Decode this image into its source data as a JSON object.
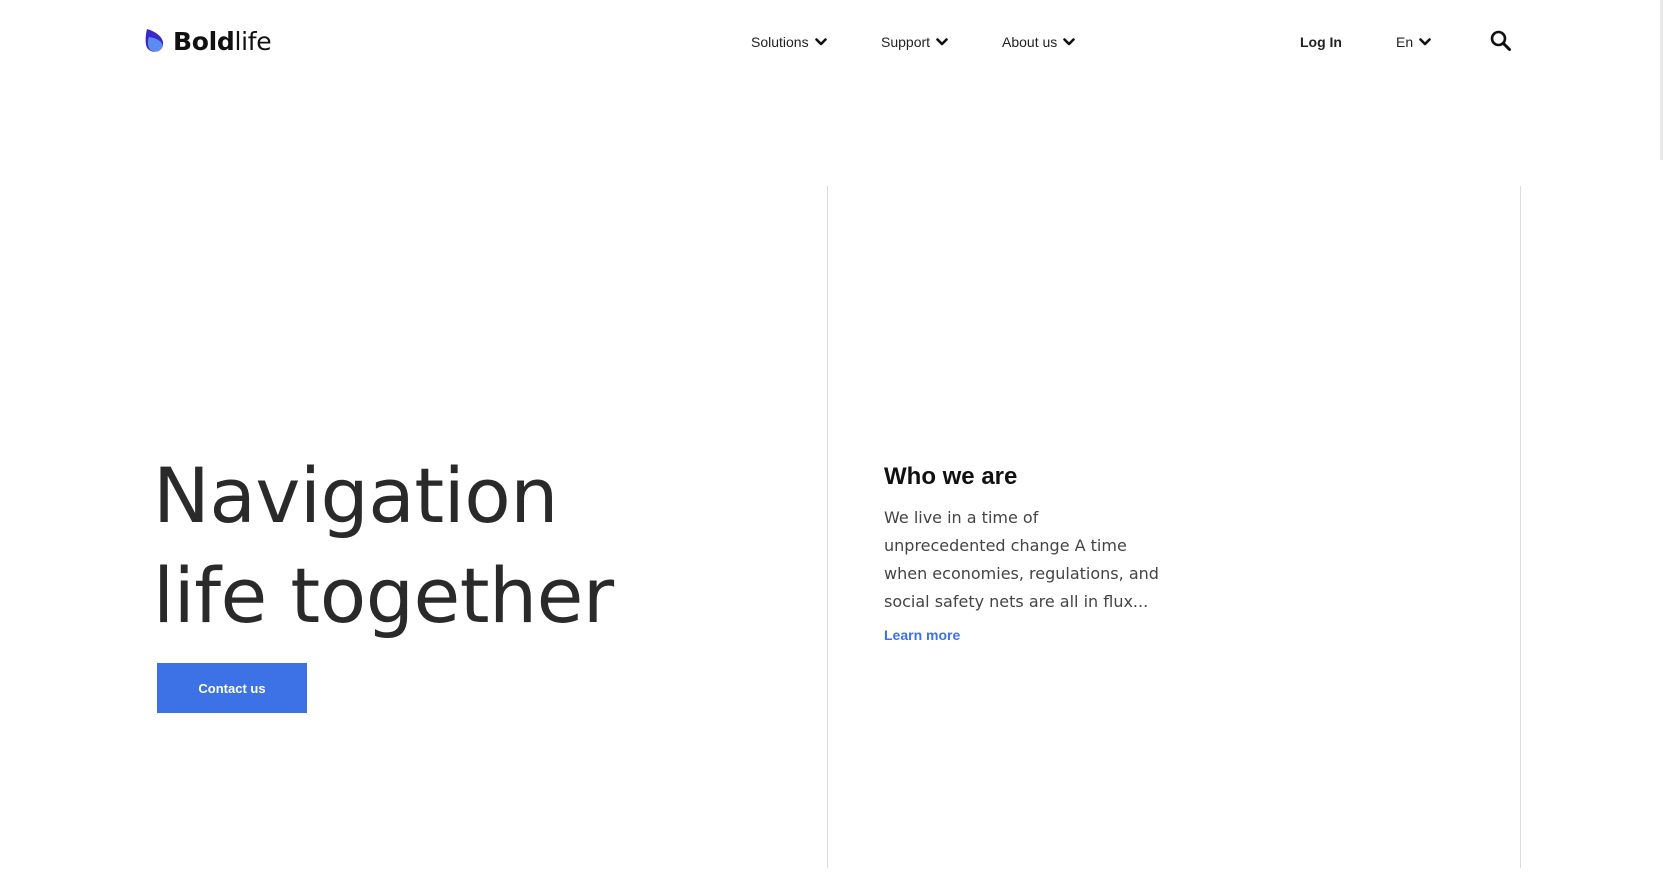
{
  "brand": {
    "name_bold": "Bold",
    "name_light": "life",
    "logo_icon": "brand-leaf-icon",
    "colors": {
      "mark_dark": "#3b28cc",
      "mark_light": "#5b8df0",
      "accent": "#3d72e6"
    }
  },
  "nav": {
    "items": [
      {
        "label": "Solutions",
        "icon": "chevron-down-icon"
      },
      {
        "label": "Support",
        "icon": "chevron-down-icon"
      },
      {
        "label": "About us",
        "icon": "chevron-down-icon"
      }
    ],
    "login_label": "Log In",
    "language": {
      "selected": "En",
      "icon": "chevron-down-icon"
    },
    "search_icon": "search-icon"
  },
  "hero": {
    "title_line1": "Navigation",
    "title_line2": "life together",
    "cta_label": "Contact us"
  },
  "about": {
    "heading": "Who we are",
    "body": "We live in a time of unprecedented change A time when economies, regulations, and social safety nets are all in flux...",
    "link_label": "Learn more"
  }
}
